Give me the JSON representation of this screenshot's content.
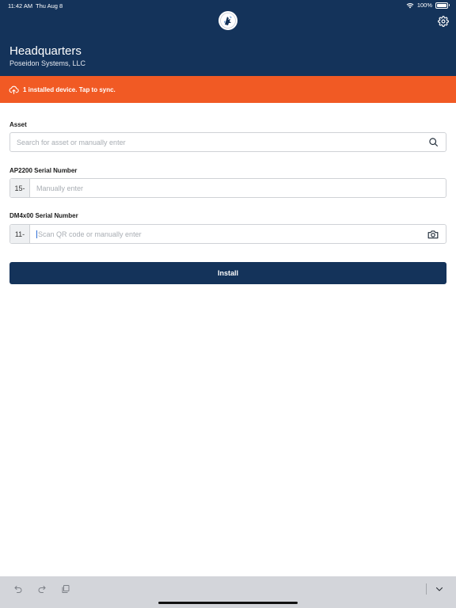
{
  "status_bar": {
    "time": "11:42 AM",
    "date": "Thu Aug 8",
    "battery": "100%"
  },
  "header": {
    "title": "Headquarters",
    "subtitle": "Poseidon Systems, LLC"
  },
  "banner": {
    "text": "1 installed device. Tap to sync."
  },
  "form": {
    "asset": {
      "label": "Asset",
      "placeholder": "Search for asset or manually enter"
    },
    "ap2200": {
      "label": "AP2200 Serial Number",
      "prefix": "15-",
      "placeholder": "Manually enter"
    },
    "dm4x00": {
      "label": "DM4x00 Serial Number",
      "prefix": "11-",
      "placeholder": "Scan QR code or manually enter"
    }
  },
  "install_button": {
    "label": "Install"
  },
  "colors": {
    "header": "#14335a",
    "banner": "#f15a24",
    "toolbar": "#d3d5da"
  },
  "icons": [
    "logo-icon",
    "settings-gear-icon",
    "cloud-upload-icon",
    "search-icon",
    "camera-icon",
    "undo-icon",
    "redo-icon",
    "paste-icon",
    "chevron-down-icon",
    "wifi-icon",
    "battery-icon"
  ]
}
